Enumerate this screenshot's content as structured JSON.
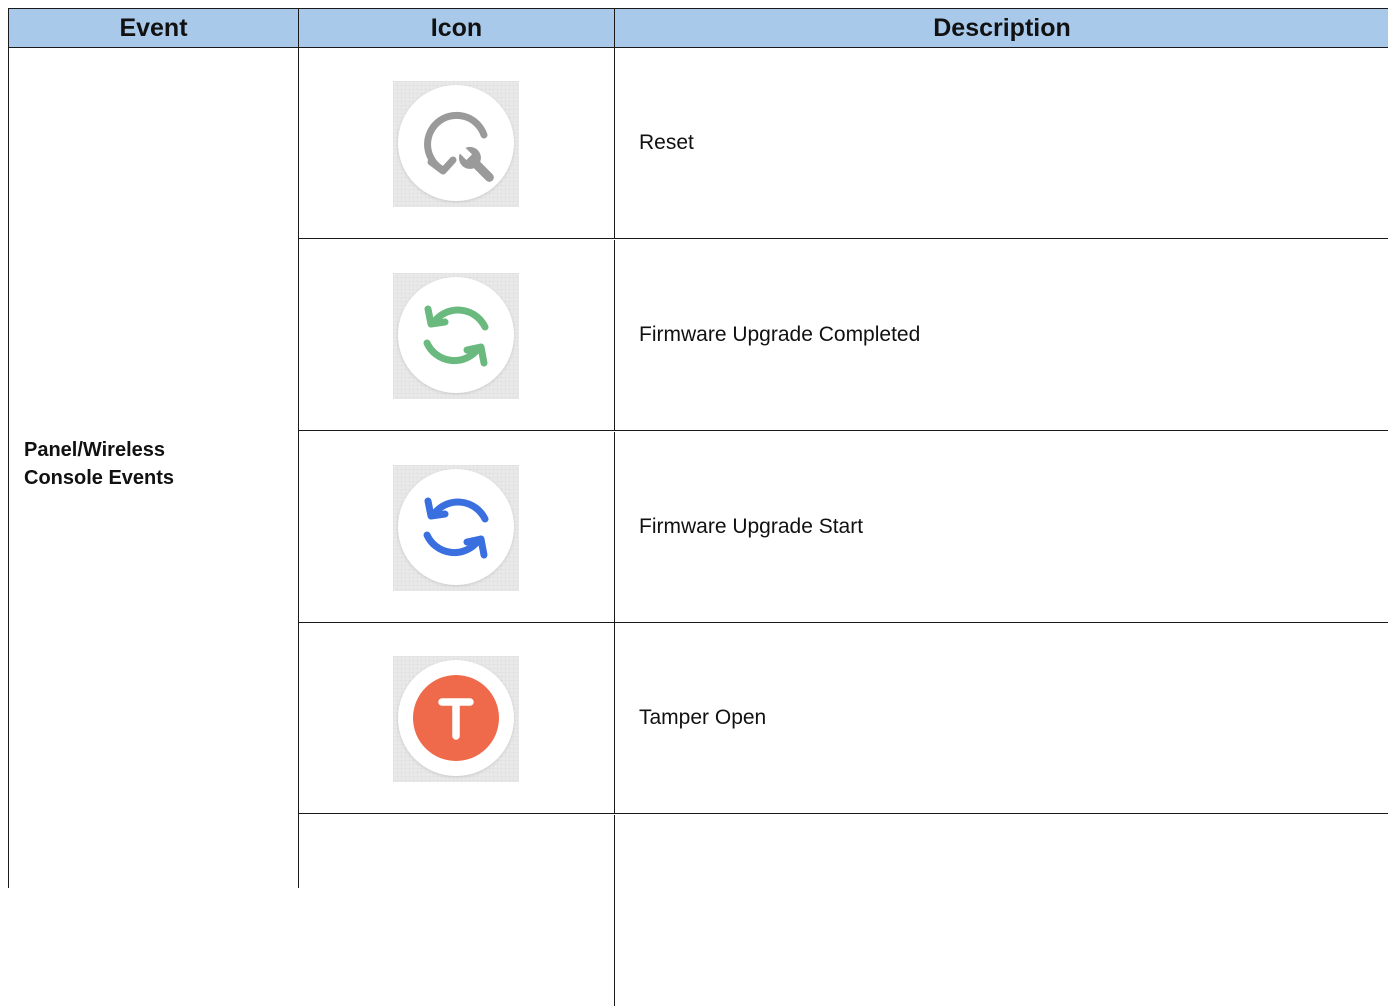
{
  "table": {
    "headers": {
      "event": "Event",
      "icon": "Icon",
      "description": "Description"
    },
    "event_group": {
      "line1": "Panel/Wireless",
      "line2": "Console Events"
    },
    "rows": [
      {
        "icon": "reset-wrench-icon",
        "icon_color": "#9a9a9a",
        "description": "Reset"
      },
      {
        "icon": "sync-complete-icon",
        "icon_color": "#6ab97e",
        "description": "Firmware Upgrade Completed"
      },
      {
        "icon": "sync-start-icon",
        "icon_color": "#3a6fe0",
        "description": "Firmware Upgrade Start"
      },
      {
        "icon": "tamper-t-icon",
        "icon_color": "#ef6a4a",
        "description": "Tamper Open"
      },
      {
        "icon": "",
        "icon_color": "",
        "description": ""
      }
    ]
  },
  "colors": {
    "header_bg": "#a9c9ea",
    "border": "#1a1a1a"
  }
}
